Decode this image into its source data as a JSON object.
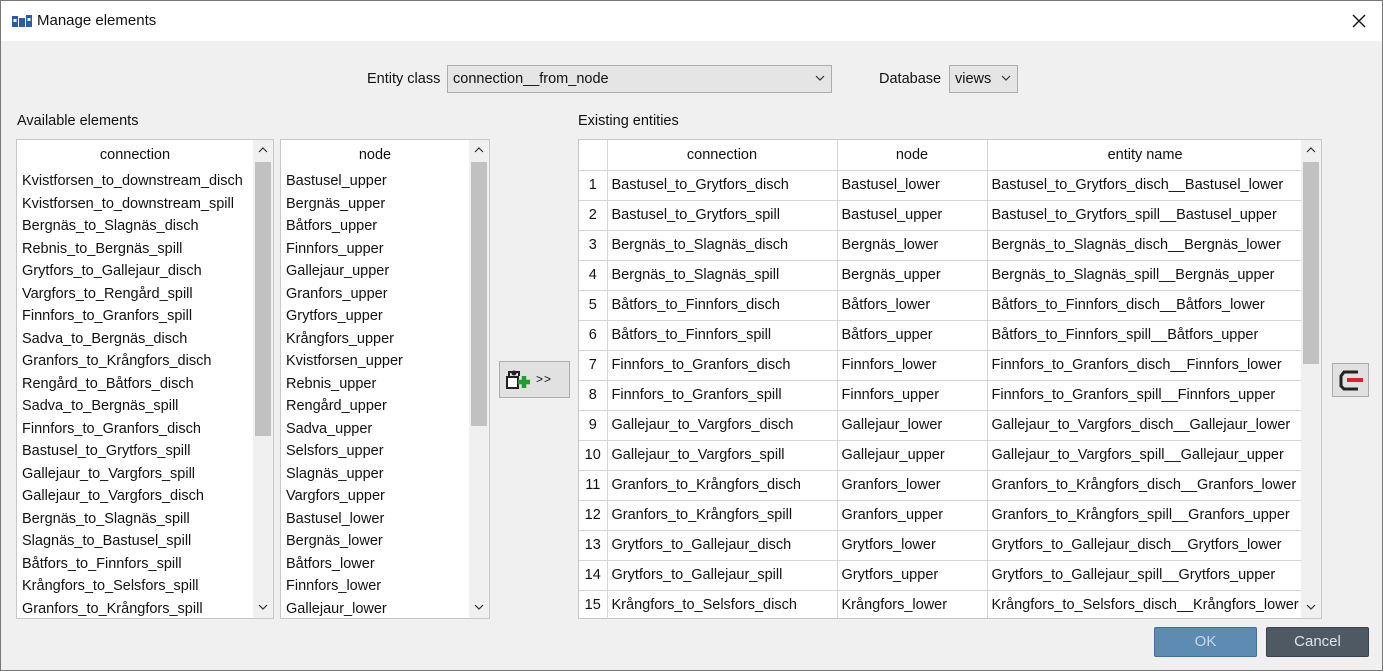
{
  "window": {
    "title": "Manage elements"
  },
  "entity_class": {
    "label": "Entity class",
    "value": "connection__from_node"
  },
  "database": {
    "label": "Database",
    "value": "views"
  },
  "available": {
    "label": "Available elements",
    "connection": {
      "header": "connection",
      "items": [
        "Kvistforsen_to_downstream_disch",
        "Kvistforsen_to_downstream_spill",
        "Bergnäs_to_Slagnäs_disch",
        "Rebnis_to_Bergnäs_spill",
        "Grytfors_to_Gallejaur_disch",
        "Vargfors_to_Rengård_spill",
        "Finnfors_to_Granfors_spill",
        "Sadva_to_Bergnäs_disch",
        "Granfors_to_Krångfors_disch",
        "Rengård_to_Båtfors_disch",
        "Sadva_to_Bergnäs_spill",
        "Finnfors_to_Granfors_disch",
        "Bastusel_to_Grytfors_spill",
        "Gallejaur_to_Vargfors_spill",
        "Gallejaur_to_Vargfors_disch",
        "Bergnäs_to_Slagnäs_spill",
        "Slagnäs_to_Bastusel_spill",
        "Båtfors_to_Finnfors_spill",
        "Krångfors_to_Selsfors_spill",
        "Granfors_to_Krångfors_spill"
      ]
    },
    "node": {
      "header": "node",
      "items": [
        "Bastusel_upper",
        "Bergnäs_upper",
        "Båtfors_upper",
        "Finnfors_upper",
        "Gallejaur_upper",
        "Granfors_upper",
        "Grytfors_upper",
        "Krångfors_upper",
        "Kvistforsen_upper",
        "Rebnis_upper",
        "Rengård_upper",
        "Sadva_upper",
        "Selsfors_upper",
        "Slagnäs_upper",
        "Vargfors_upper",
        "Bastusel_lower",
        "Bergnäs_lower",
        "Båtfors_lower",
        "Finnfors_lower",
        "Gallejaur_lower"
      ]
    }
  },
  "add_button": {
    "label": ">>"
  },
  "existing": {
    "label": "Existing entities",
    "columns": [
      "connection",
      "node",
      "entity name"
    ],
    "rows": [
      [
        "1",
        "Bastusel_to_Grytfors_disch",
        "Bastusel_lower",
        "Bastusel_to_Grytfors_disch__Bastusel_lower"
      ],
      [
        "2",
        "Bastusel_to_Grytfors_spill",
        "Bastusel_upper",
        "Bastusel_to_Grytfors_spill__Bastusel_upper"
      ],
      [
        "3",
        "Bergnäs_to_Slagnäs_disch",
        "Bergnäs_lower",
        "Bergnäs_to_Slagnäs_disch__Bergnäs_lower"
      ],
      [
        "4",
        "Bergnäs_to_Slagnäs_spill",
        "Bergnäs_upper",
        "Bergnäs_to_Slagnäs_spill__Bergnäs_upper"
      ],
      [
        "5",
        "Båtfors_to_Finnfors_disch",
        "Båtfors_lower",
        "Båtfors_to_Finnfors_disch__Båtfors_lower"
      ],
      [
        "6",
        "Båtfors_to_Finnfors_spill",
        "Båtfors_upper",
        "Båtfors_to_Finnfors_spill__Båtfors_upper"
      ],
      [
        "7",
        "Finnfors_to_Granfors_disch",
        "Finnfors_lower",
        "Finnfors_to_Granfors_disch__Finnfors_lower"
      ],
      [
        "8",
        "Finnfors_to_Granfors_spill",
        "Finnfors_upper",
        "Finnfors_to_Granfors_spill__Finnfors_upper"
      ],
      [
        "9",
        "Gallejaur_to_Vargfors_disch",
        "Gallejaur_lower",
        "Gallejaur_to_Vargfors_disch__Gallejaur_lower"
      ],
      [
        "10",
        "Gallejaur_to_Vargfors_spill",
        "Gallejaur_upper",
        "Gallejaur_to_Vargfors_spill__Gallejaur_upper"
      ],
      [
        "11",
        "Granfors_to_Krångfors_disch",
        "Granfors_lower",
        "Granfors_to_Krångfors_disch__Granfors_lower"
      ],
      [
        "12",
        "Granfors_to_Krångfors_spill",
        "Granfors_upper",
        "Granfors_to_Krångfors_spill__Granfors_upper"
      ],
      [
        "13",
        "Grytfors_to_Gallejaur_disch",
        "Grytfors_lower",
        "Grytfors_to_Gallejaur_disch__Grytfors_lower"
      ],
      [
        "14",
        "Grytfors_to_Gallejaur_spill",
        "Grytfors_upper",
        "Grytfors_to_Gallejaur_spill__Grytfors_upper"
      ],
      [
        "15",
        "Krångfors_to_Selsfors_disch",
        "Krångfors_lower",
        "Krångfors_to_Selsfors_disch__Krångfors_lower"
      ]
    ]
  },
  "buttons": {
    "ok": "OK",
    "cancel": "Cancel"
  },
  "icons": {
    "app": "app-icon",
    "close": "close-icon",
    "add": "add-entity-icon",
    "remove": "remove-entity-icon",
    "dropdown": "chevron-down-icon"
  },
  "colors": {
    "ok_bg": "#5d8bb1",
    "cancel_bg": "#4f5963",
    "add_green": "#1f9d2f",
    "remove_red": "#e0202a"
  }
}
